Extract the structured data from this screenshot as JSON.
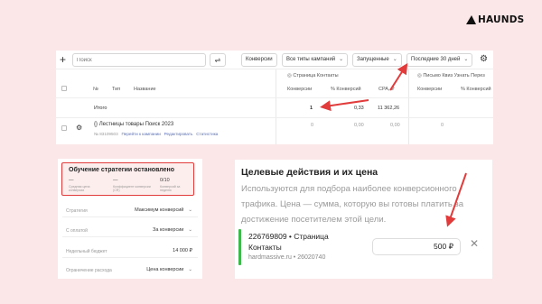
{
  "brand": {
    "logo_text": "HAUNDS"
  },
  "toolbar": {
    "search_placeholder": "Поиск",
    "buttons": [
      "Конверсии",
      "Все типы кампаний",
      "Запущенные",
      "Последние 30 дней"
    ]
  },
  "table": {
    "headers": {
      "no": "№",
      "type": "Тип",
      "name": "Название"
    },
    "groups": [
      "Страница Контакты",
      "Письмо Квиз Узнать Перез"
    ],
    "columns": [
      "Конверсии",
      "% Конверсий",
      "CPA, ₽"
    ],
    "total": {
      "label": "Итого",
      "conversions": "1",
      "pct": "0,33",
      "cpa": "11 362,26"
    },
    "row": {
      "name": "Лестницы товары Поиск 2023",
      "meta": "№ 83109503",
      "links": [
        "Перейти к кампании",
        "Редактировать",
        "Статистика"
      ],
      "conversions": "0",
      "pct": "0,00",
      "cpa": "0,00",
      "extra": "0"
    }
  },
  "strategy": {
    "alert_title": "Обучение стратегии остановлено",
    "stats": [
      {
        "value": "—",
        "label": "Средняя цена конверсии"
      },
      {
        "value": "—",
        "label": "Коэффициент конверсии (CR)"
      },
      {
        "value": "0/10",
        "label": "Конверсий за неделю"
      }
    ],
    "rows": [
      {
        "label": "Стратегия",
        "value": "Максимум конверсий"
      },
      {
        "label": "С оплатой",
        "value": "За конверсии"
      },
      {
        "label": "Недельный бюджет",
        "value": "14 000 ₽"
      },
      {
        "label": "Ограничение расхода",
        "value": "Цена конверсии"
      }
    ]
  },
  "goals": {
    "title": "Целевые действия и их цена",
    "description": "Используются для подбора наиболее конверсионного трафика. Цена — сумма, которую вы готовы платить за достижение посетителем этой цели.",
    "item": {
      "name_line1": "226769809 • Страница",
      "name_line2": "Контакты",
      "site": "hardmassive.ru • 26020740",
      "price": "500 ₽"
    }
  },
  "colors": {
    "accent_red": "#e23b3b",
    "goal_green": "#3fb84b",
    "background": "#fbe7e7"
  }
}
